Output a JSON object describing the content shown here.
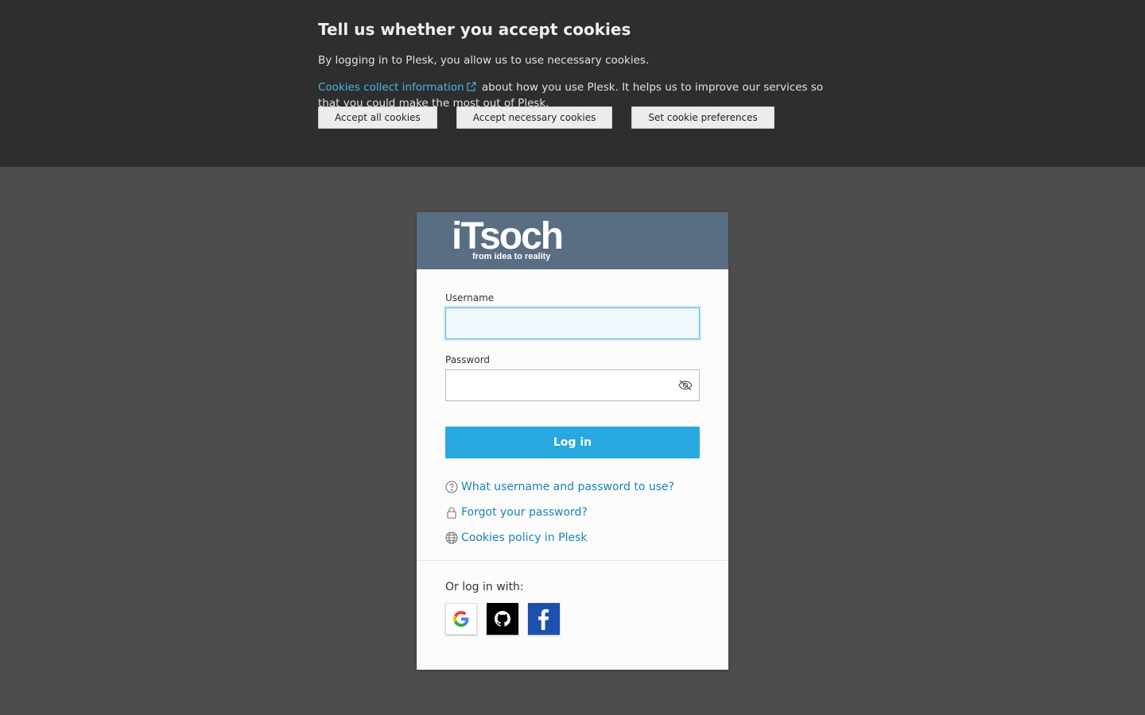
{
  "cookie_banner": {
    "title": "Tell us whether you accept cookies",
    "paragraph1": "By logging in to Plesk, you allow us to use necessary cookies.",
    "link_text": "Cookies collect information",
    "paragraph2_rest": "about how you use Plesk. It helps us to improve our services so that you could make the most out of Plesk.",
    "buttons": {
      "accept_all": "Accept all cookies",
      "accept_necessary": "Accept necessary cookies",
      "preferences": "Set cookie preferences"
    }
  },
  "logo": {
    "text": "iTsoch",
    "tagline": "from idea to reality"
  },
  "login": {
    "username_label": "Username",
    "username_value": "",
    "password_label": "Password",
    "password_value": "",
    "submit_label": "Log in",
    "links": {
      "help": "What username and password to use?",
      "forgot": "Forgot your password?",
      "cookies_policy": "Cookies policy in Plesk"
    },
    "social_label": "Or log in with:",
    "social_providers": [
      "google-icon",
      "github-icon",
      "facebook-icon"
    ]
  },
  "colors": {
    "banner_bg": "#2e2e2e",
    "page_bg": "#4d4d4d",
    "header_bg": "#5a6e83",
    "primary_button": "#28a8de",
    "link": "#1b84b6",
    "banner_link": "#45b5e6"
  }
}
